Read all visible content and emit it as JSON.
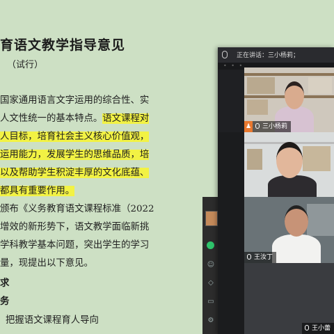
{
  "document": {
    "title": "育语文教学指导意见",
    "subtitle": "（试行）",
    "lines": [
      {
        "text": "国家通用语言文字运用的综合性、实",
        "highlight": ""
      },
      {
        "text": "人文性统一的基本特点。",
        "highlight": "语文课程对"
      },
      {
        "text": "人目标，培育社会主义核心价值观，",
        "highlight": "all"
      },
      {
        "text": "运用能力，发展学生的思维品质，培",
        "highlight": "all"
      },
      {
        "text": "以及帮助学生积淀丰厚的文化底蕴、",
        "highlight": "all"
      },
      {
        "text": "都具有重要作用。",
        "highlight": "all"
      },
      {
        "text": "颁布《义务教育语文课程标准（2022",
        "highlight": ""
      },
      {
        "text": "增效的新形势下，语文教学面临新挑",
        "highlight": ""
      },
      {
        "text": "学科教学基本问题，突出学生的学习",
        "highlight": ""
      },
      {
        "text": "量，现提出以下意见。",
        "highlight": ""
      },
      {
        "text": "求",
        "highlight": ""
      },
      {
        "text": "务",
        "highlight": ""
      },
      {
        "text": "把握语文课程育人导向",
        "highlight": ""
      }
    ]
  },
  "meeting": {
    "speaking_label": "正在讲话：三小杨莉；",
    "participants": [
      {
        "name": "三小杨莉",
        "role": "host"
      },
      {
        "name": "",
        "role": ""
      },
      {
        "name": "王汝丁",
        "role": ""
      },
      {
        "name": "王小蕾",
        "role": ""
      }
    ]
  },
  "colors": {
    "highlight": "#f2f244",
    "host_badge": "#e8782f",
    "doc_bg": "#cde0c4"
  }
}
